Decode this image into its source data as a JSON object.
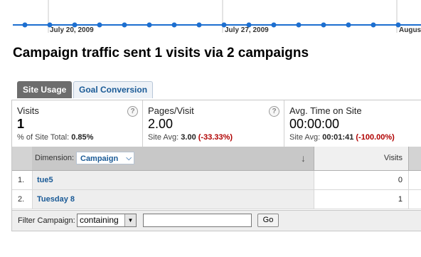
{
  "timeline": {
    "dates": [
      "July 20, 2009",
      "July 27, 2009",
      "Augus"
    ],
    "line_color": "#1d6fd0"
  },
  "title": "Campaign traffic sent 1 visits via 2 campaigns",
  "tabs": [
    {
      "label": "Site Usage",
      "active": true
    },
    {
      "label": "Goal Conversion",
      "active": false
    }
  ],
  "metrics": [
    {
      "label": "Visits",
      "value": "1",
      "sub_prefix": "% of Site Total:",
      "sub_value": "0.85%",
      "sub_delta": ""
    },
    {
      "label": "Pages/Visit",
      "value": "2.00",
      "sub_prefix": "Site Avg:",
      "sub_value": "3.00",
      "sub_delta": "(-33.33%)"
    },
    {
      "label": "Avg. Time on Site",
      "value": "00:00:00",
      "sub_prefix": "Site Avg:",
      "sub_value": "00:01:41",
      "sub_delta": "(-100.00%)"
    }
  ],
  "table": {
    "dimension_label": "Dimension:",
    "dimension_value": "Campaign",
    "visits_header": "Visits",
    "rows": [
      {
        "index": "1.",
        "name": "tue5",
        "visits": "0"
      },
      {
        "index": "2.",
        "name": "Tuesday 8",
        "visits": "1"
      }
    ]
  },
  "filter": {
    "label": "Filter Campaign:",
    "mode": "containing",
    "input_value": "",
    "go_label": "Go"
  },
  "icons": {
    "help": "help-icon",
    "sort": "sort-down-arrow-icon",
    "dropdown": "chevron-down-icon"
  }
}
